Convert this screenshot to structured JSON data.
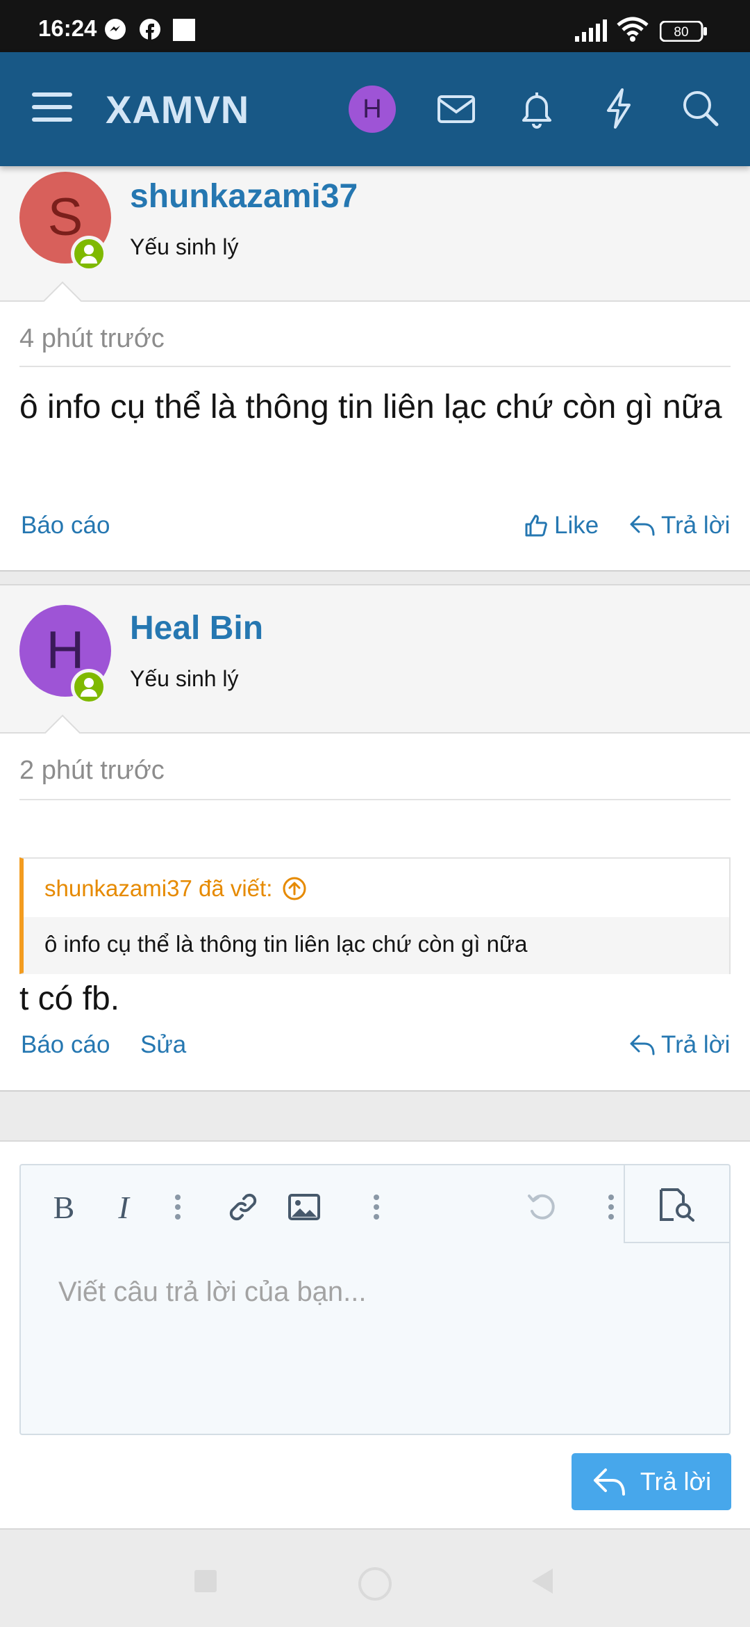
{
  "status_bar": {
    "time": "16:24",
    "battery": "80"
  },
  "header": {
    "logo": "XAMVN",
    "avatar_letter": "H"
  },
  "posts": [
    {
      "avatar_letter": "S",
      "avatar_color": "#d8605b",
      "avatar_text_color": "#7a1f1b",
      "username": "shunkazami37",
      "user_title": "Yếu sinh lý",
      "time": "4 phút trước",
      "message": "ô info cụ thể là thông tin liên lạc chứ còn gì nữa",
      "report_label": "Báo cáo",
      "like_label": "Like",
      "reply_label": "Trả lời"
    },
    {
      "avatar_letter": "H",
      "avatar_color": "#9e54d6",
      "avatar_text_color": "#3a1a58",
      "username": "Heal Bin",
      "user_title": "Yếu sinh lý",
      "time": "2 phút trước",
      "quote_author": "shunkazami37 đã viết:",
      "quote_text": "ô info cụ thể là thông tin liên lạc chứ còn gì nữa",
      "message": "t có fb.",
      "report_label": "Báo cáo",
      "edit_label": "Sửa",
      "reply_label": "Trả lời"
    }
  ],
  "editor": {
    "placeholder": "Viết câu trả lời của bạn...",
    "submit_label": "Trả lời"
  },
  "colors": {
    "header": "#185886",
    "link": "#2577b1",
    "accent": "#47a7eb",
    "quote_bar": "#f39c1f",
    "online": "#7fb900"
  }
}
